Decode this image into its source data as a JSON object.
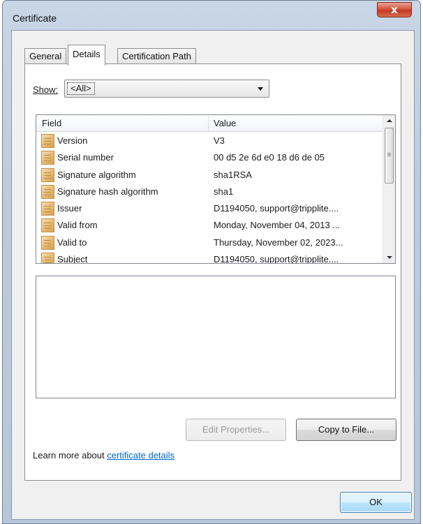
{
  "window": {
    "title": "Certificate",
    "close_glyph": "x"
  },
  "tabs": [
    {
      "label": "General",
      "active": false
    },
    {
      "label": "Details",
      "active": true
    },
    {
      "label": "Certification Path",
      "active": false
    }
  ],
  "show": {
    "label": "Show:",
    "selected": "<All>"
  },
  "list": {
    "columns": {
      "field": "Field",
      "value": "Value"
    },
    "rows": [
      {
        "field": "Version",
        "value": "V3"
      },
      {
        "field": "Serial number",
        "value": "00 d5 2e 6d e0 18 d6 de 05"
      },
      {
        "field": "Signature algorithm",
        "value": "sha1RSA"
      },
      {
        "field": "Signature hash algorithm",
        "value": "sha1"
      },
      {
        "field": "Issuer",
        "value": "D1194050, support@tripplite...."
      },
      {
        "field": "Valid from",
        "value": "Monday, November 04, 2013 ..."
      },
      {
        "field": "Valid to",
        "value": "Thursday, November 02, 2023..."
      },
      {
        "field": "Subject",
        "value": "D1194050, support@tripplite...."
      }
    ]
  },
  "buttons": {
    "edit_properties": "Edit Properties...",
    "copy_to_file": "Copy to File...",
    "ok": "OK"
  },
  "learn_more": {
    "prefix": "Learn more about ",
    "link_text": "certificate details"
  }
}
